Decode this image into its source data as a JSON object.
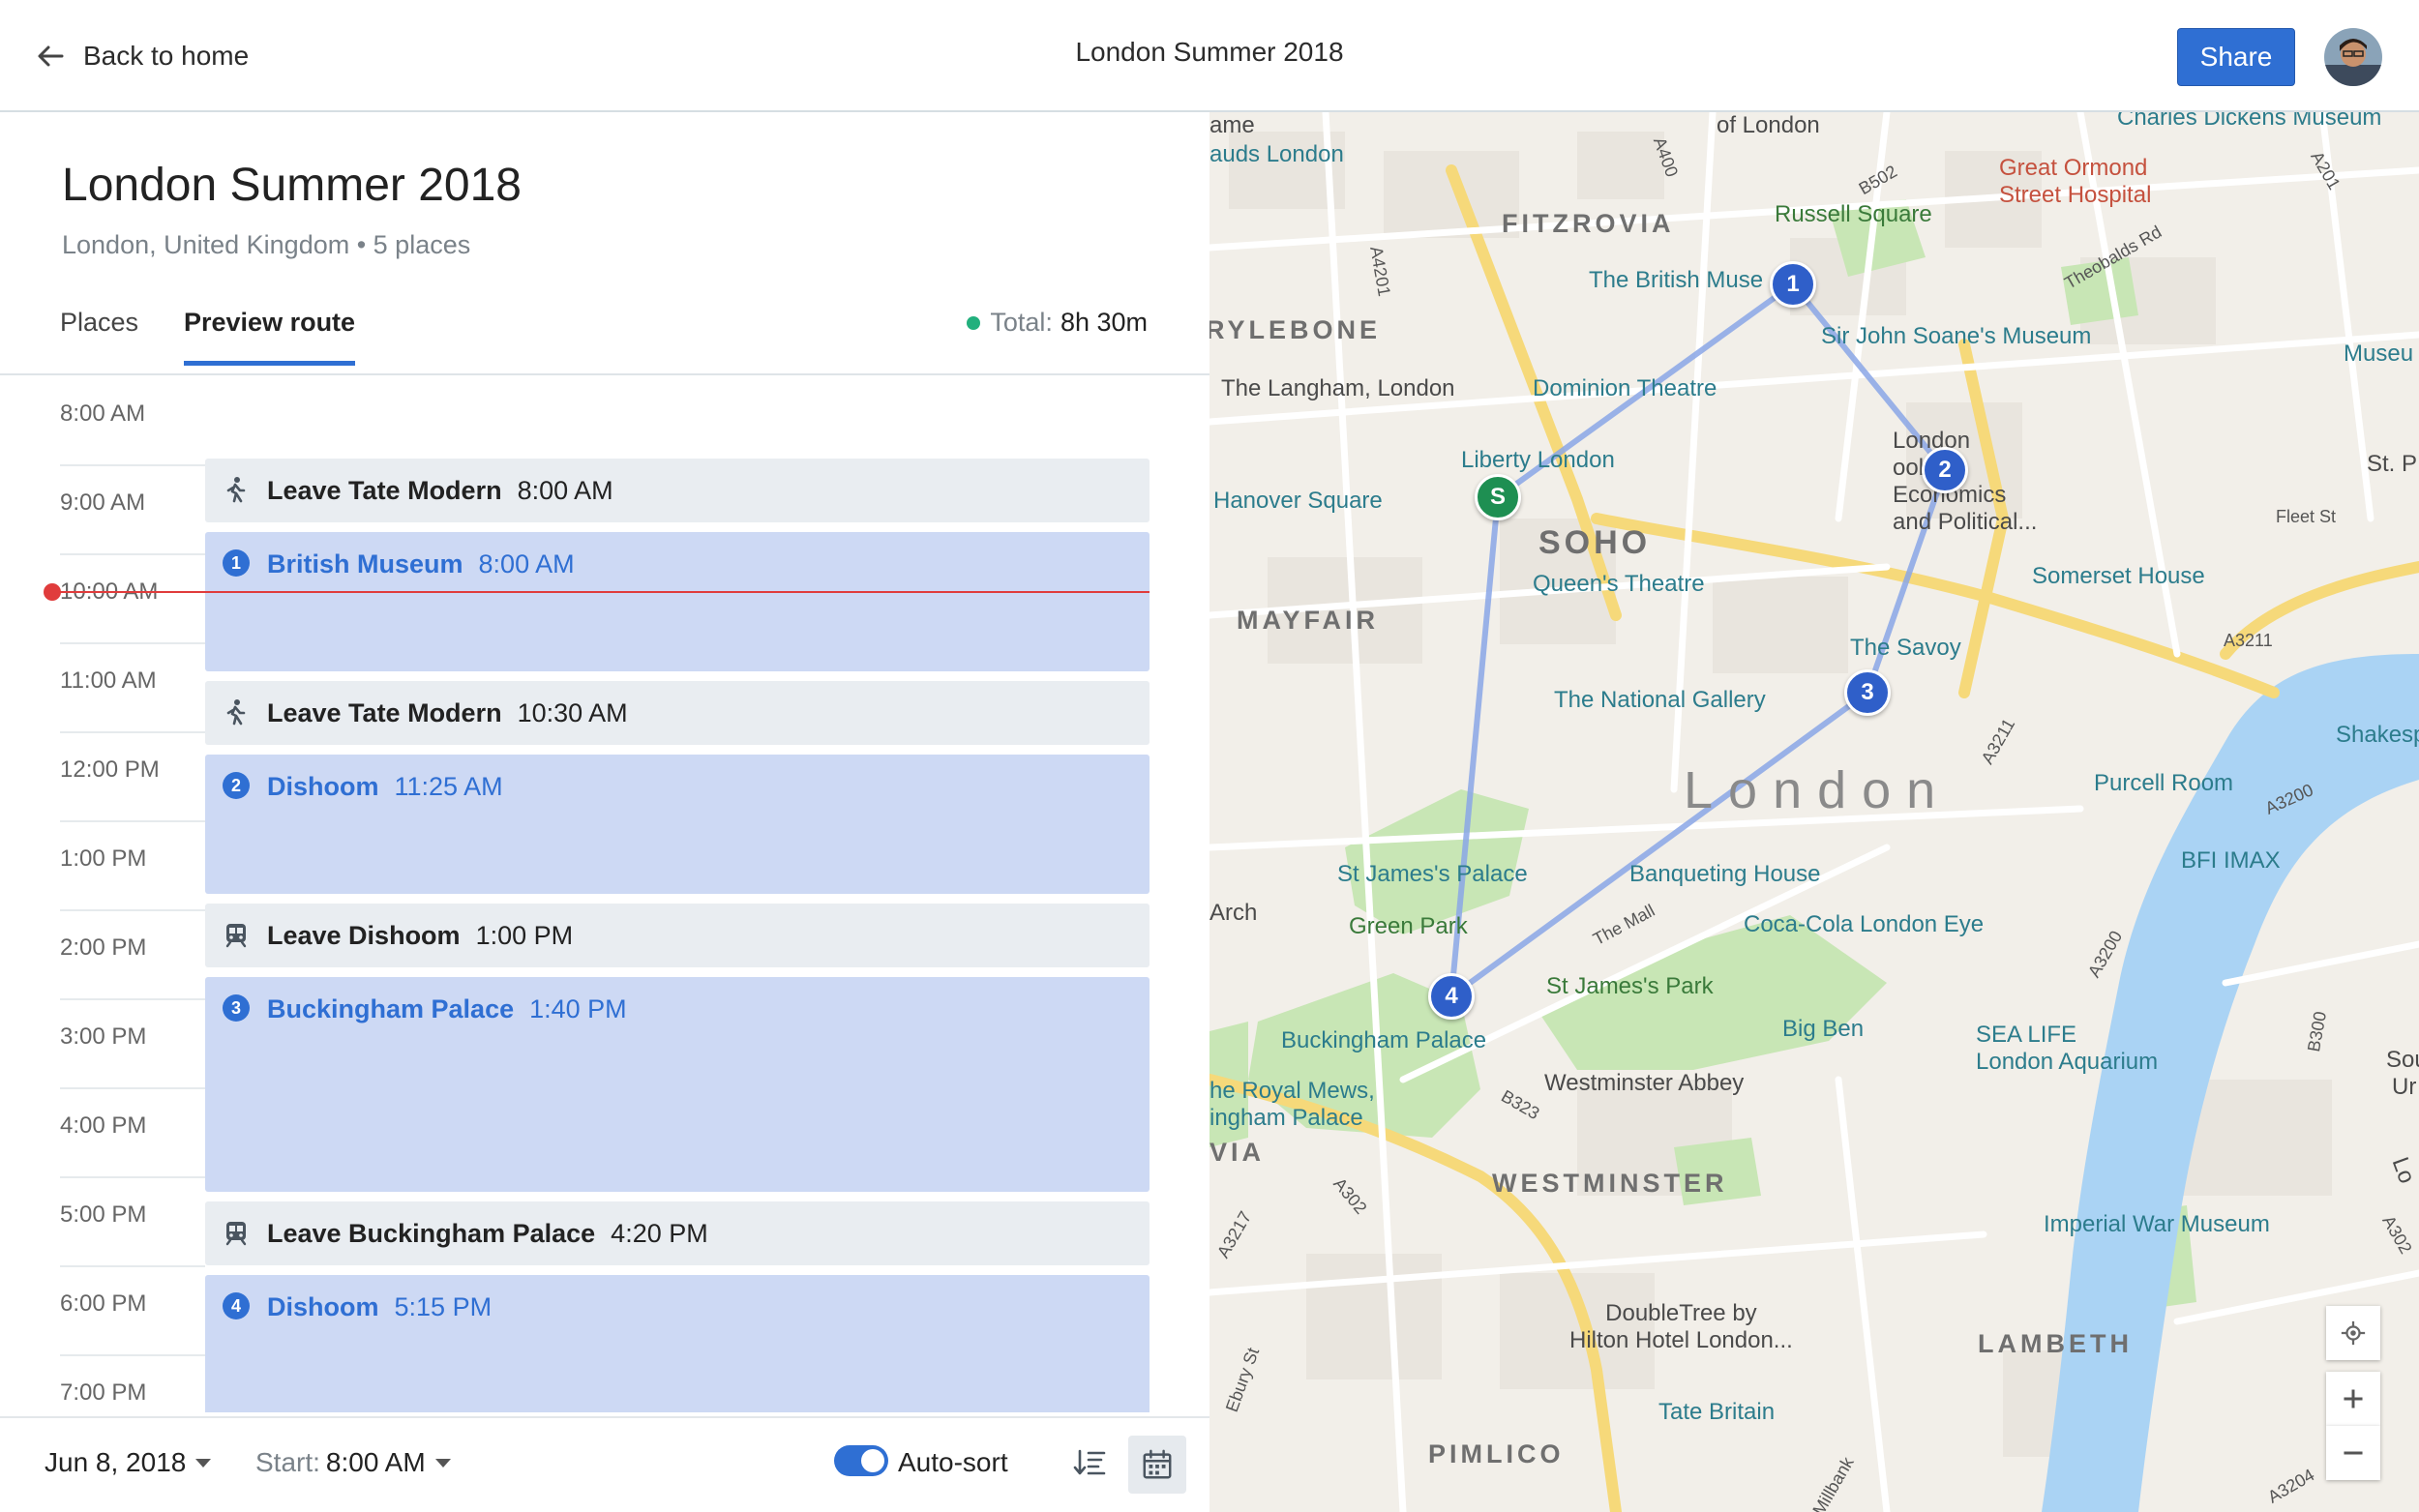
{
  "header": {
    "back_label": "Back to home",
    "title": "London Summer 2018",
    "share_label": "Share"
  },
  "trip": {
    "title": "London Summer 2018",
    "subtitle": "London, United Kingdom • 5 places"
  },
  "tabs": {
    "places": "Places",
    "preview_route": "Preview route",
    "active": "preview_route"
  },
  "total": {
    "label": "Total:",
    "value": "8h 30m"
  },
  "timeline": {
    "hours": [
      "8:00 AM",
      "9:00 AM",
      "10:00 AM",
      "11:00 AM",
      "12:00 PM",
      "1:00 PM",
      "2:00 PM",
      "3:00 PM",
      "4:00 PM",
      "5:00 PM",
      "6:00 PM",
      "7:00 PM"
    ],
    "events": [
      {
        "kind": "leave",
        "icon": "walk-icon",
        "name": "Leave Tate Modern",
        "time": "8:00 AM"
      },
      {
        "kind": "stop",
        "number": "1",
        "name": "British Museum",
        "time": "8:00 AM"
      },
      {
        "kind": "leave",
        "icon": "walk-icon",
        "name": "Leave Tate Modern",
        "time": "10:30 AM"
      },
      {
        "kind": "stop",
        "number": "2",
        "name": "Dishoom",
        "time": "11:25 AM"
      },
      {
        "kind": "leave",
        "icon": "train-icon",
        "name": "Leave Dishoom",
        "time": "1:00 PM"
      },
      {
        "kind": "stop",
        "number": "3",
        "name": "Buckingham Palace",
        "time": "1:40 PM"
      },
      {
        "kind": "leave",
        "icon": "train-icon",
        "name": "Leave Buckingham Palace",
        "time": "4:20 PM"
      },
      {
        "kind": "stop",
        "number": "4",
        "name": "Dishoom",
        "time": "5:15 PM"
      }
    ]
  },
  "footer": {
    "date": "Jun 8, 2018",
    "start_label": "Start:",
    "start_value": "8:00 AM",
    "autosort_label": "Auto-sort",
    "autosort_on": true
  },
  "map": {
    "markers": [
      "S",
      "1",
      "2",
      "3",
      "4"
    ],
    "labels": {
      "fitzrovia": "FITZROVIA",
      "marylebone": "RYLEBONE",
      "soho": "SOHO",
      "mayfair": "MAYFAIR",
      "london": "London",
      "westminster": "WESTMINSTER",
      "lambeth": "LAMBETH",
      "pimlico": "PIMLICO",
      "via": "VIA",
      "british_museum": "The British Muse",
      "russell_square": "Russell Square",
      "of_london": "of London",
      "great_ormond": "Great Ormond\nStreet Hospital",
      "charles_dickens": "Charles Dickens Museum",
      "soane": "Sir John Soane's Museum",
      "museu": "Museu",
      "langham": "The Langham, London",
      "dominion": "Dominion Theatre",
      "liberty": "Liberty London",
      "hanover": "Hanover Square",
      "lse": "London\nool of\nEconomics\nand Political...",
      "st_p": "St. P",
      "fleet_st": "Fleet St",
      "queens_theatre": "Queen's Theatre",
      "somerset": "Somerset House",
      "savoy": "The Savoy",
      "a3211": "A3211",
      "national_gallery": "The National Gallery",
      "shakespe": "Shakespe",
      "purcell": "Purcell Room",
      "a3200": "A3200",
      "bfi": "BFI IMAX",
      "st_james_palace": "St James's Palace",
      "banqueting": "Banqueting House",
      "arch": "Arch",
      "green_park": "Green Park",
      "the_mall": "The Mall",
      "coca_cola": "Coca-Cola London Eye",
      "st_james_park": "St James's Park",
      "big_ben": "Big Ben",
      "sea_life": "SEA LIFE\nLondon Aquarium",
      "buckingham": "Buckingham Palace",
      "royal_mews": "he Royal Mews,\ningham Palace",
      "westminster_abbey": "Westminster Abbey",
      "b323": "B323",
      "a302": "A302",
      "a3217": "A3217",
      "imperial_war": "Imperial War Museum",
      "a302b": "A302",
      "doubletree": "DoubleTree by\nHilton Hotel London...",
      "tate_britain": "Tate Britain",
      "ebury": "Ebury St",
      "millbank": "Millbank",
      "a3204": "A3204",
      "a400": "A400",
      "a4201": "A4201",
      "b502": "B502",
      "theobalds": "Theobalds Rd",
      "a201": "A201",
      "b300": "B300",
      "a3200b": "A3200",
      "a3211b": "A3211",
      "ame": "ame",
      "auds": "auds London",
      "sou": "Sou",
      "ur": "Ur",
      "lo": "Lo"
    }
  },
  "colors": {
    "accent": "#2f6fd3",
    "stop_bg": "#cdd9f4",
    "leave_bg": "#e9edf1",
    "now_line": "#e03c3c",
    "start_marker": "#1e8f52",
    "route_marker": "#2f5fc9",
    "water": "#aad3f4",
    "park": "#c8e6b5"
  }
}
